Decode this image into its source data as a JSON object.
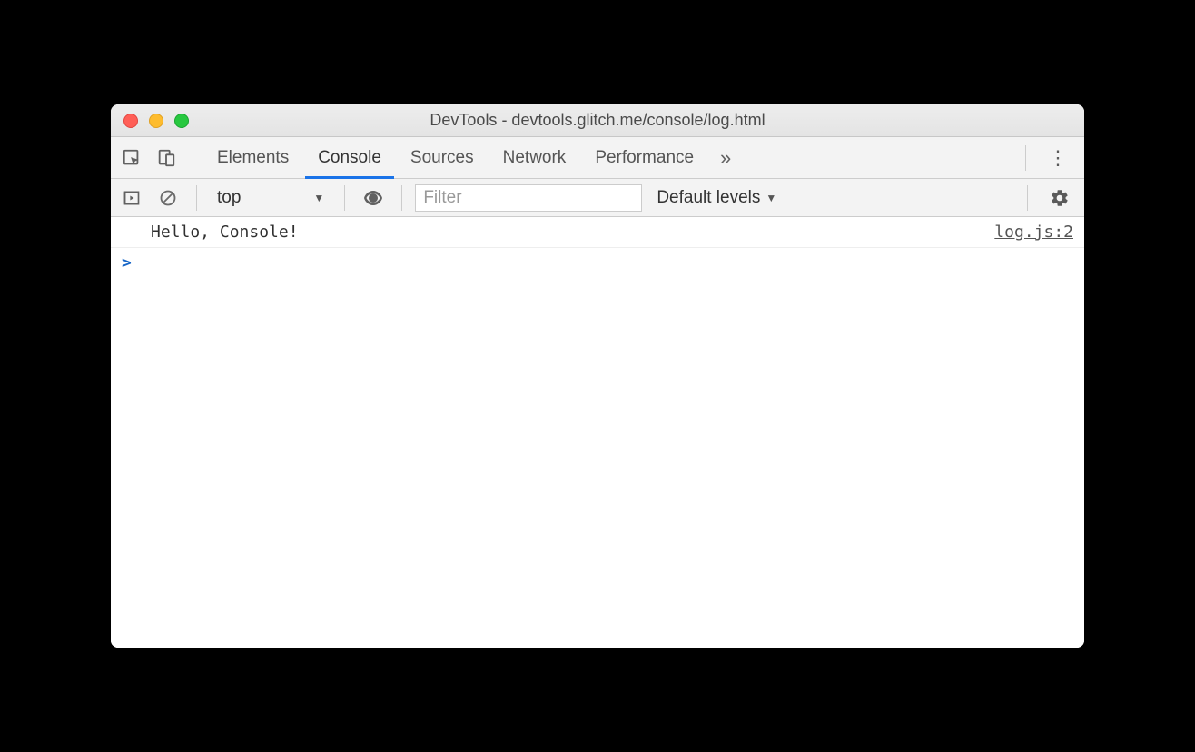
{
  "window": {
    "title": "DevTools - devtools.glitch.me/console/log.html"
  },
  "tabs": {
    "elements": "Elements",
    "console": "Console",
    "sources": "Sources",
    "network": "Network",
    "performance": "Performance"
  },
  "consoleToolbar": {
    "context": "top",
    "filterPlaceholder": "Filter",
    "levels": "Default levels"
  },
  "log": {
    "message": "Hello, Console!",
    "source": "log.js:2"
  },
  "prompt": ">"
}
